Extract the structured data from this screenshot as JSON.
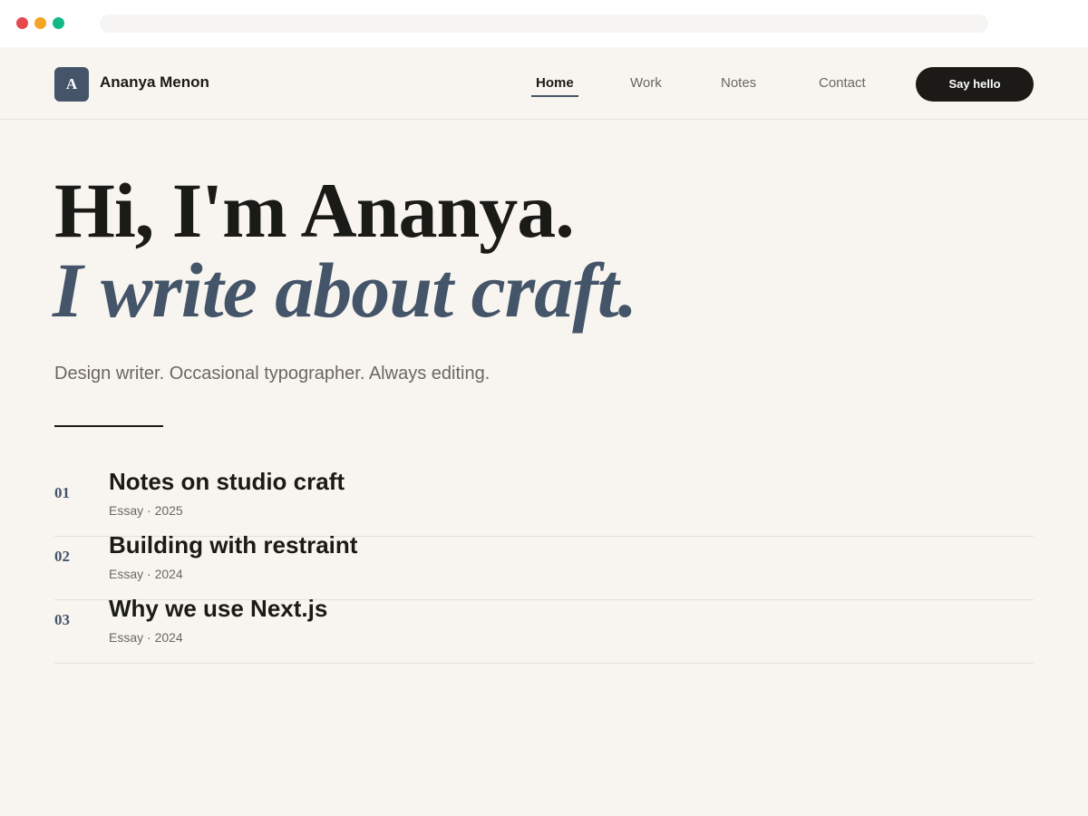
{
  "browser": {
    "traffic_light_colors": [
      "#e5484d",
      "#f5a524",
      "#12b886"
    ]
  },
  "header": {
    "logo_letter": "A",
    "site_name": "Ananya Menon",
    "nav": [
      {
        "label": "Home",
        "active": true
      },
      {
        "label": "Work",
        "active": false
      },
      {
        "label": "Notes",
        "active": false
      },
      {
        "label": "Contact",
        "active": false
      }
    ],
    "cta_label": "Say hello"
  },
  "hero": {
    "line1": "Hi, I'm Ananya.",
    "line2": "I write about craft.",
    "tagline": "Design writer. Occasional typographer. Always editing."
  },
  "articles": [
    {
      "number": "01",
      "title": "Notes on studio craft",
      "meta": "Essay · 2025"
    },
    {
      "number": "02",
      "title": "Building with restraint",
      "meta": "Essay · 2024"
    },
    {
      "number": "03",
      "title": "Why we use Next.js",
      "meta": "Essay · 2024"
    }
  ],
  "colors": {
    "background": "#f8f5f0",
    "accent": "#455569",
    "text": "#1a1a17",
    "muted": "#6b6760",
    "cta_background": "#1c1a17"
  }
}
